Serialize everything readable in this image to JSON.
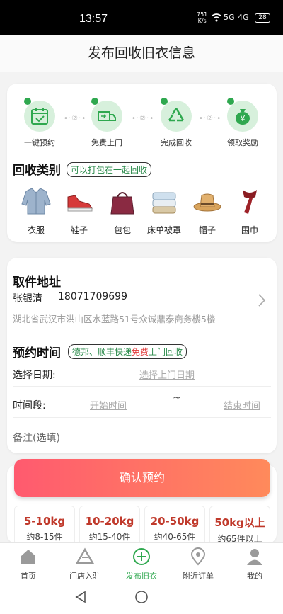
{
  "status": {
    "time": "13:57",
    "net_speed": "751",
    "net_unit": "K/s",
    "signal1": "5G",
    "signal2": "4G",
    "battery": "28"
  },
  "header": {
    "title": "发布回收旧衣信息"
  },
  "steps": [
    {
      "label": "一键预约",
      "icon": "calendar-check-icon"
    },
    {
      "label": "免费上门",
      "icon": "truck-icon"
    },
    {
      "label": "完成回收",
      "icon": "recycle-icon"
    },
    {
      "label": "领取奖励",
      "icon": "money-bag-icon"
    }
  ],
  "step_dots": "•·②·•",
  "categories": {
    "title": "回收类别",
    "tag": "可以打包在一起回收",
    "items": [
      {
        "label": "衣服",
        "icon": "jacket-icon"
      },
      {
        "label": "鞋子",
        "icon": "sneaker-icon"
      },
      {
        "label": "包包",
        "icon": "handbag-icon"
      },
      {
        "label": "床单被罩",
        "icon": "folded-sheets-icon"
      },
      {
        "label": "帽子",
        "icon": "hat-icon"
      },
      {
        "label": "围巾",
        "icon": "scarf-icon"
      }
    ]
  },
  "address": {
    "title": "取件地址",
    "name": "张银清",
    "phone": "18071709699",
    "detail": "湖北省武汉市洪山区水蓝路51号众诚鼎泰商务楼5楼"
  },
  "appointment": {
    "title": "预约时间",
    "tag_pre": "德邦、顺丰快递",
    "tag_free": "免费",
    "tag_post": "上门回收",
    "date_label": "选择日期:",
    "date_placeholder": "选择上门日期",
    "time_label": "时间段:",
    "start_placeholder": "开始时间",
    "tilde": "~",
    "end_placeholder": "结束时间",
    "note_label": "备注(选填)"
  },
  "confirm_button": "确认预约",
  "weights": [
    {
      "weight": "5-10kg",
      "count": "约8-15件"
    },
    {
      "weight": "10-20kg",
      "count": "约15-40件"
    },
    {
      "weight": "20-50kg",
      "count": "约40-65件"
    },
    {
      "weight": "50kg以上",
      "count": "约65件以上"
    }
  ],
  "tabs": [
    {
      "label": "首页",
      "icon": "home-icon"
    },
    {
      "label": "门店入驻",
      "icon": "store-icon"
    },
    {
      "label": "发布旧衣",
      "icon": "add-circle-icon"
    },
    {
      "label": "附近订单",
      "icon": "location-pin-icon"
    },
    {
      "label": "我的",
      "icon": "person-icon"
    }
  ],
  "colors": {
    "accent_green": "#2fa84f",
    "button_gradient_start": "#ff5a6f",
    "button_gradient_end": "#ff8a5b",
    "weight_red": "#c0392b"
  }
}
